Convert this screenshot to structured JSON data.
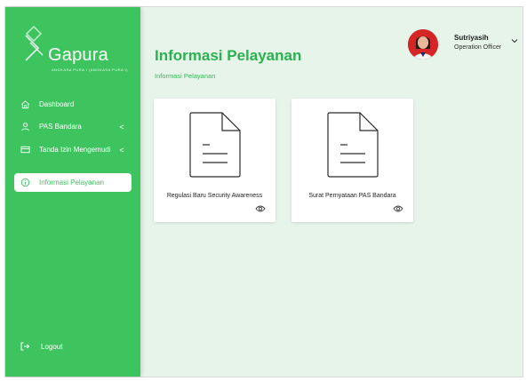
{
  "brand": {
    "name": "Gapura",
    "tagline": "ANGKASA PURA I (ANGKASA PURA I)"
  },
  "sidebar": {
    "items": [
      {
        "label": "Dashboard",
        "icon": "home-icon",
        "chevron": ""
      },
      {
        "label": "PAS Bandara",
        "icon": "user-icon",
        "chevron": "<"
      },
      {
        "label": "Tanda Izin Mengemudi",
        "icon": "card-icon",
        "chevron": "<"
      },
      {
        "label": "Informasi Pelayanan",
        "icon": "info-icon",
        "chevron": ""
      }
    ],
    "logout_label": "Logout"
  },
  "header": {
    "title": "Informasi Pelayanan",
    "breadcrumb": "Informasi Pelayanan"
  },
  "user": {
    "name": "Sutriyasih",
    "role": "Operation Officer"
  },
  "cards": [
    {
      "label": "Regulasi Baru Security Awareness"
    },
    {
      "label": "Surat Pernyataan PAS Bandara"
    }
  ],
  "colors": {
    "accent": "#3ec45f",
    "background": "#e6f4ea",
    "title": "#2bb14f"
  }
}
